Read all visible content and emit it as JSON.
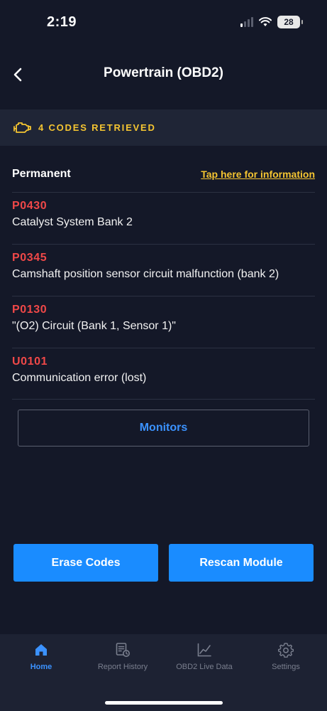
{
  "status_bar": {
    "time": "2:19",
    "battery": "28"
  },
  "header": {
    "title": "Powertrain (OBD2)"
  },
  "banner": {
    "icon": "engine-icon",
    "text": "4 CODES RETRIEVED"
  },
  "section": {
    "label": "Permanent",
    "info_link": "Tap here for information"
  },
  "codes": [
    {
      "code": "P0430",
      "description": "Catalyst System Bank 2"
    },
    {
      "code": "P0345",
      "description": "Camshaft position sensor circuit malfunction (bank 2)"
    },
    {
      "code": "P0130",
      "description": "\"(O2) Circuit (Bank 1, Sensor 1)\""
    },
    {
      "code": "U0101",
      "description": "Communication error (lost)"
    }
  ],
  "buttons": {
    "monitors": "Monitors",
    "erase": "Erase Codes",
    "rescan": "Rescan Module"
  },
  "tabs": [
    {
      "label": "Home",
      "icon": "home-icon",
      "active": true
    },
    {
      "label": "Report History",
      "icon": "report-icon",
      "active": false
    },
    {
      "label": "OBD2 Live Data",
      "icon": "chart-icon",
      "active": false
    },
    {
      "label": "Settings",
      "icon": "gear-icon",
      "active": false
    }
  ],
  "colors": {
    "background": "#141828",
    "accent": "#1a8cff",
    "warning": "#f5c531",
    "code_red": "#f04848"
  }
}
